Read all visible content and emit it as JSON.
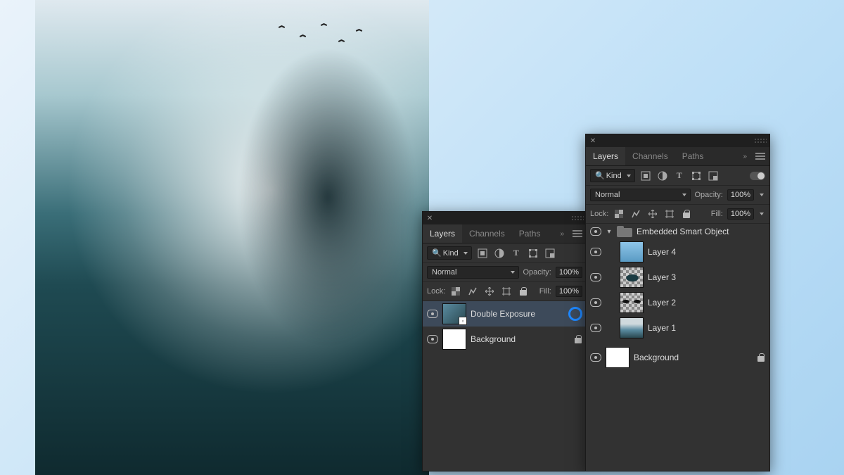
{
  "tabs": {
    "layers": "Layers",
    "channels": "Channels",
    "paths": "Paths"
  },
  "filter": {
    "search_icon": "search-icon",
    "kind": "Kind"
  },
  "blend": {
    "mode": "Normal",
    "opacity_label": "Opacity:",
    "opacity_value": "100%"
  },
  "lock": {
    "label": "Lock:",
    "fill_label": "Fill:",
    "fill_value": "100%"
  },
  "panel_left": {
    "layers": [
      {
        "name": "Double Exposure",
        "selected": true,
        "thumb": "image",
        "smart": true,
        "ring": true
      },
      {
        "name": "Background",
        "thumb": "white",
        "locked": true
      }
    ]
  },
  "panel_right": {
    "group_name": "Embedded Smart Object",
    "layers": [
      {
        "name": "Layer 4",
        "thumb": "blue"
      },
      {
        "name": "Layer 3",
        "thumb": "checker"
      },
      {
        "name": "Layer 2",
        "thumb": "checker"
      },
      {
        "name": "Layer 1",
        "thumb": "blue"
      }
    ],
    "background_name": "Background"
  }
}
